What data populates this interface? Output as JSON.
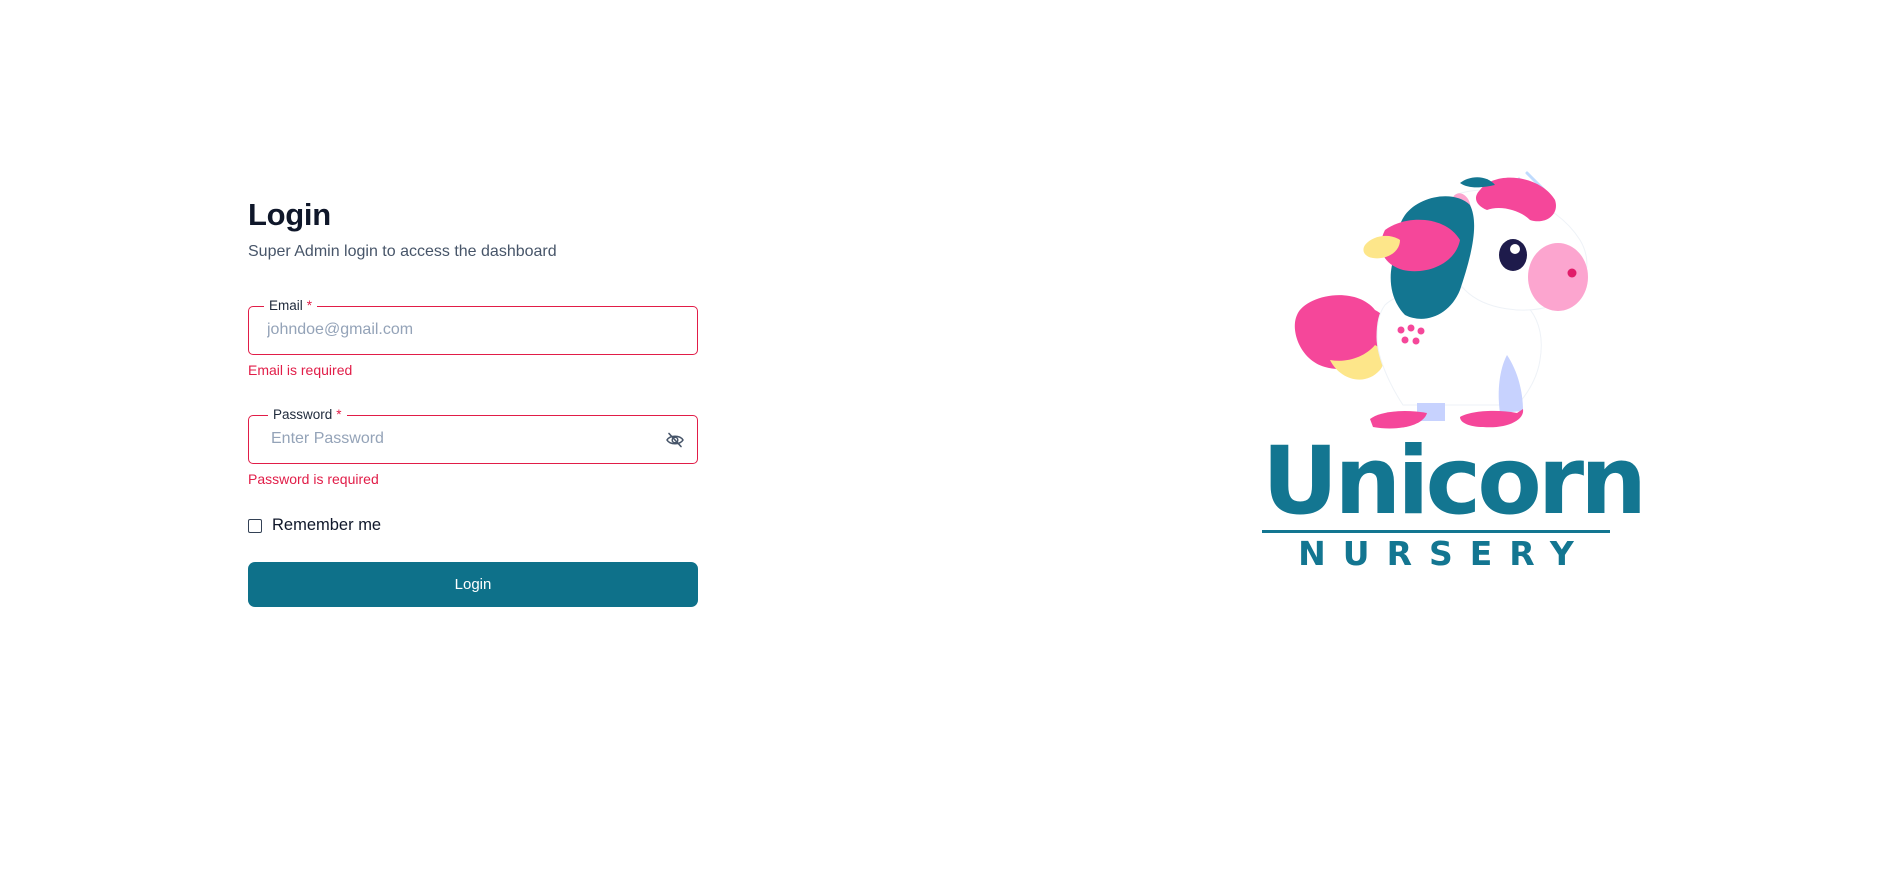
{
  "login": {
    "title": "Login",
    "subtitle": "Super Admin login to access the dashboard",
    "email": {
      "label": "Email",
      "required_mark": "*",
      "placeholder": "johndoe@gmail.com",
      "value": "",
      "error": "Email is required"
    },
    "password": {
      "label": "Password",
      "required_mark": "*",
      "placeholder": "Enter Password",
      "value": "",
      "error": "Password is required",
      "toggle_icon": "eye-off-icon"
    },
    "remember": {
      "label": "Remember me",
      "checked": false
    },
    "submit_label": "Login"
  },
  "brand": {
    "name": "Unicorn",
    "tagline": "NURSERY",
    "logo_icon": "unicorn-mascot-icon"
  },
  "colors": {
    "primary": "#0e718a",
    "brand_teal": "#137691",
    "error": "#e11d48",
    "mane_pink": "#f5479a",
    "mane_yellow": "#fde68a",
    "snout_pink": "#fca5cf"
  }
}
